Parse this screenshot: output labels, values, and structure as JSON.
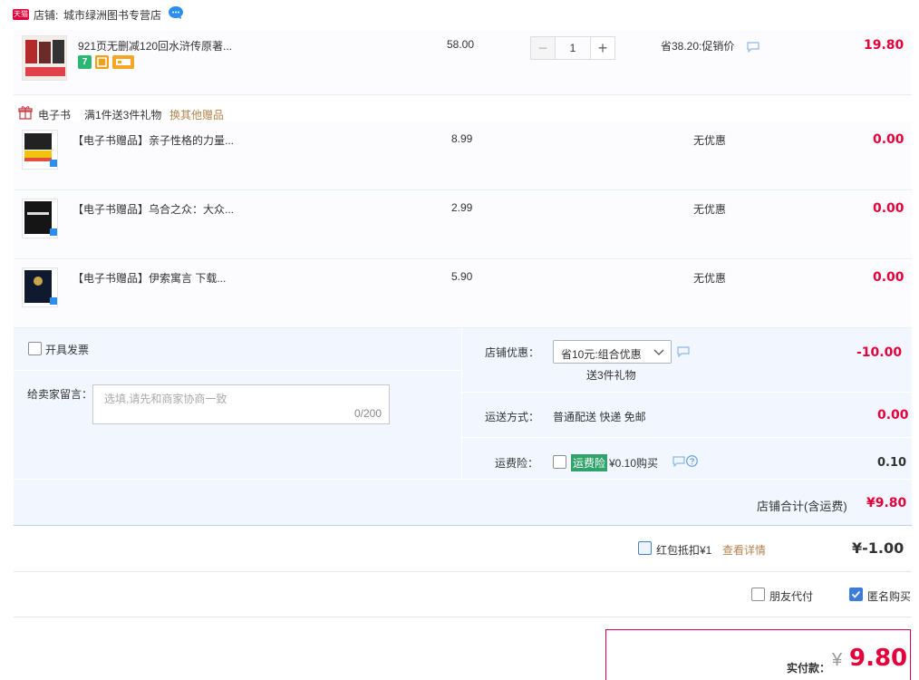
{
  "shop": {
    "badge": "天猫",
    "label": "店铺:",
    "name": "城市绿洲图书专营店"
  },
  "main_item": {
    "title": "921页无删减120回水浒传原著...",
    "unit_price": "58.00",
    "quantity": "1",
    "minus": "−",
    "plus": "+",
    "discount": "省38.20:促销价",
    "subtotal": "19.80",
    "tags": [
      "7"
    ]
  },
  "gift_bar": {
    "type": "电子书",
    "rule": "满1件送3件礼物",
    "change_link": "换其他赠品"
  },
  "gifts": [
    {
      "title": "【电子书赠品】亲子性格的力量...",
      "price": "8.99",
      "discount": "无优惠",
      "subtotal": "0.00"
    },
    {
      "title": "【电子书赠品】乌合之众：大众...",
      "price": "2.99",
      "discount": "无优惠",
      "subtotal": "0.00"
    },
    {
      "title": "【电子书赠品】伊索寓言 下载...",
      "price": "5.90",
      "discount": "无优惠",
      "subtotal": "0.00"
    }
  ],
  "invoice": {
    "label": "开具发票"
  },
  "message": {
    "label": "给卖家留言：",
    "placeholder": "选填,请先和商家协商一致",
    "counter": "0/200"
  },
  "shop_discount": {
    "label": "店铺优惠：",
    "selected": "省10元:组合优惠",
    "note": "送3件礼物",
    "amount": "-10.00"
  },
  "shipping": {
    "label": "运送方式：",
    "value": "普通配送 快递 免邮",
    "amount": "0.00"
  },
  "insurance": {
    "label": "运费险：",
    "badge": "运费险",
    "price": "¥0.10购买",
    "amount": "0.10"
  },
  "shop_total": {
    "label": "店铺合计(含运费)",
    "amount": "¥9.80"
  },
  "red_packet": {
    "label": "红包抵扣¥1",
    "link": "查看详情",
    "amount": "¥-1.00"
  },
  "friend_pay": {
    "label": "朋友代付"
  },
  "anonymous": {
    "label": "匿名购买"
  },
  "final": {
    "label": "实付款：",
    "currency": "¥",
    "amount": "9.80"
  },
  "colors": {
    "accent_red": "#e4003a",
    "panel_bg": "#f2f7ff",
    "link_brown": "#b4844e",
    "checkbox_blue": "#3c7dda",
    "insurance_green": "#2fa36a"
  }
}
